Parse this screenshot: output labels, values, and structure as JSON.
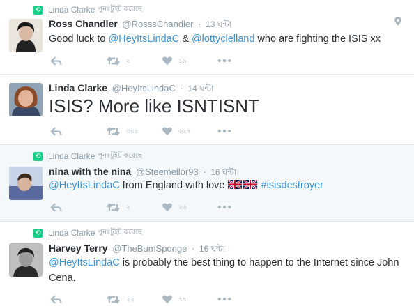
{
  "tweets": [
    {
      "retweeted_by": "Linda Clarke",
      "retweet_label": "পুনঃটুইট করেছে",
      "name": "Ross Chandler",
      "handle": "@RosssChandler",
      "separator": "·",
      "time": "13 ঘন্টা",
      "text_parts": [
        "Good luck to ",
        "@HeyItsLindaC",
        " & ",
        "@lottyclelland",
        " who are fighting the ISIS xx"
      ],
      "retweets": "২",
      "likes": "১৯",
      "icons": [
        "reply-icon",
        "retweet-icon",
        "like-icon",
        "more-icon",
        "location-pin-icon"
      ]
    },
    {
      "name": "Linda Clarke",
      "handle": "@HeyItsLindaC",
      "separator": "·",
      "time": "14 ঘন্টা",
      "text": "ISIS? More like ISNTISNT",
      "retweets": "৩৪৪",
      "likes": "৬২৭"
    },
    {
      "retweeted_by": "Linda Clarke",
      "retweet_label": "পুনঃটুইট করেছে",
      "name": "nina with the nina",
      "handle": "@Steemellor93",
      "separator": "·",
      "time": "16 ঘন্টা",
      "text_parts": [
        "@HeyItsLindaC",
        " from England with love ",
        "#isisdestroyer"
      ],
      "retweets": "২",
      "likes": "২৬",
      "icons": [
        "uk-flag-icon",
        "uk-flag-icon"
      ]
    },
    {
      "retweeted_by": "Linda Clarke",
      "retweet_label": "পুনঃটুইট করেছে",
      "name": "Harvey Terry",
      "handle": "@TheBumSponge",
      "separator": "·",
      "time": "16 ঘন্টা",
      "text_parts": [
        "@HeyItsLindaC",
        " is probably the best thing to happen to the Internet since John Cena."
      ],
      "retweets": "২২",
      "likes": "৭৭"
    }
  ],
  "colors": {
    "link": "#3b94d9",
    "muted": "#8899a6",
    "retweet_green": "#19cf86",
    "highlight_bg": "#f5f8fa"
  }
}
